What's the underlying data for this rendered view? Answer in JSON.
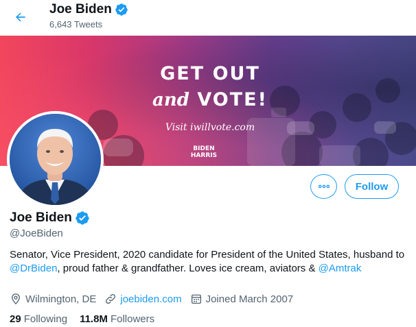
{
  "header": {
    "back_icon": "arrow-left-icon",
    "name": "Joe Biden",
    "verified_icon": "verified-badge-icon",
    "tweet_count": "6,643 Tweets"
  },
  "banner": {
    "line1": "GET OUT",
    "line2_script": "and",
    "line2_bold": "VOTE!",
    "visit_text": "Visit iwillvote.com",
    "logo_line1": "BIDEN",
    "logo_line2": "HARRIS"
  },
  "profile": {
    "avatar_icon": "profile-photo",
    "name": "Joe Biden",
    "handle": "@JoeBiden",
    "bio_part1": "Senator, Vice President, 2020 candidate for President of the United States, husband to ",
    "bio_mention1": "@DrBiden",
    "bio_part2": ", proud father & grandfather. Loves ice cream, aviators & ",
    "bio_mention2": "@Amtrak",
    "location": "Wilmington, DE",
    "website": "joebiden.com",
    "joined": "Joined March 2007",
    "following_count": "29",
    "following_label": "Following",
    "followers_count": "11.8M",
    "followers_label": "Followers"
  },
  "actions": {
    "more_icon": "more-options-icon",
    "follow_label": "Follow"
  },
  "colors": {
    "accent": "#1d9bf0",
    "text": "#0f1419",
    "secondary_text": "#536471"
  }
}
